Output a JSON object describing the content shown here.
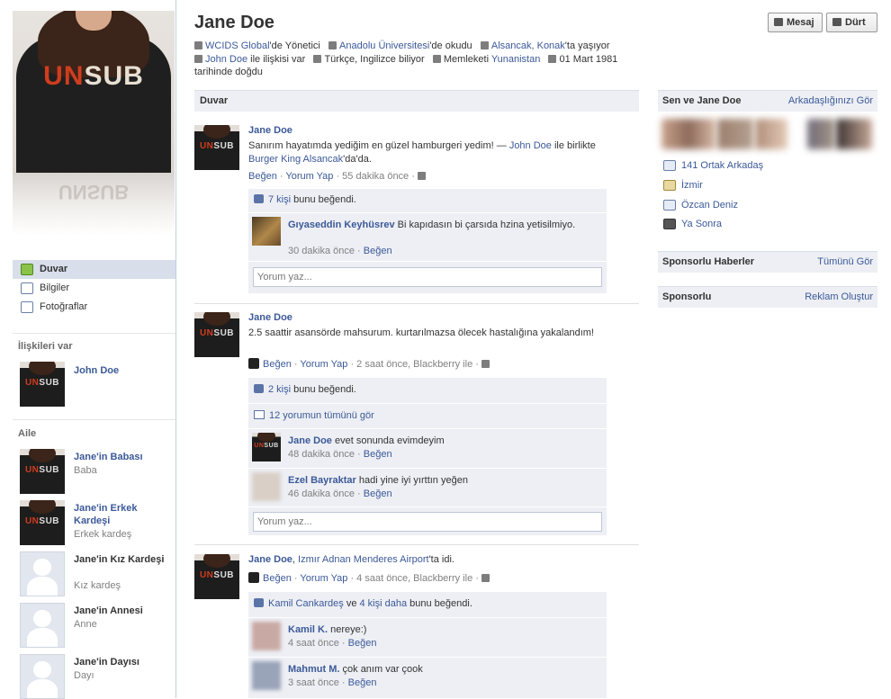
{
  "profile": {
    "name": "Jane Doe",
    "shirt_logo_red": "UN",
    "shirt_logo_white": "SUB"
  },
  "info": {
    "work_org": "WCIDS Global",
    "work_suffix": "'de Yönetici",
    "school": "Anadolu Üniversitesi",
    "school_suffix": "'de okudu",
    "location": "Alsancak, Konak",
    "location_suffix": "'ta yaşıyor",
    "partner": "John Doe",
    "partner_suffix": " ile ilişkisi var",
    "languages": "Türkçe, Ingilizce biliyor",
    "hometown_prefix": "Memleketi ",
    "hometown": "Yunanistan",
    "birthday": "01 Mart 1981 tarihinde doğdu"
  },
  "buttons": {
    "message": "Mesaj",
    "poke": "Dürt"
  },
  "nav": [
    {
      "label": "Duvar"
    },
    {
      "label": "Bilgiler"
    },
    {
      "label": "Fotoğraflar"
    }
  ],
  "relationship": {
    "heading": "İlişkileri var",
    "name": "John Doe"
  },
  "family": {
    "heading": "Aile",
    "members": [
      {
        "name": "Jane'in Babası",
        "role": "Baba"
      },
      {
        "name": "Jane'in Erkek Kardeşi",
        "role": "Erkek kardeş"
      },
      {
        "name": "Jane'in Kız Kardeşi",
        "role": "Kız kardeş"
      },
      {
        "name": "Jane'in Annesi",
        "role": "Anne"
      },
      {
        "name": "Jane'in Dayısı",
        "role": "Dayı"
      }
    ]
  },
  "wall_heading": "Duvar",
  "actions": {
    "like": "Beğen",
    "comment": "Yorum Yap",
    "comment_placeholder": "Yorum yaz..."
  },
  "posts": [
    {
      "author": "Jane Doe",
      "text_a": "Sanırım hayatımda yediğim en güzel hamburgeri yedim! — ",
      "text_tag": "John Doe",
      "text_b": " ile birlikte ",
      "text_place": "Burger King Alsancak",
      "text_c": "'da'da.",
      "meta": " · 55 dakika önce · ",
      "likes_link": "7 kişi",
      "likes_text": " bunu beğendi.",
      "comments": [
        {
          "author": "Gıyaseddin Keyhüsrev",
          "text": "Bi kapıdasın bi çarsıda hzina yetisilmiyo.",
          "time": "30 dakika önce · "
        }
      ]
    },
    {
      "author": "Jane Doe",
      "text": "2.5 saattir asansörde mahsurum. kurtarılmazsa ölecek hastalığına yakalandım!",
      "meta": " · 2 saat önce, Blackberry ile · ",
      "likes_link": "2 kişi",
      "likes_text": " bunu beğendi.",
      "all_comments": "12 yorumun tümünü gör",
      "comments": [
        {
          "author": "Jane Doe",
          "text": "evet sonunda evimdeyim",
          "time": "48 dakika önce · "
        },
        {
          "author": "Ezel Bayraktar",
          "text": "hadi yine iyi yırttın yeğen",
          "time": "46 dakika önce · "
        }
      ]
    },
    {
      "author": "Jane Doe",
      "checkin_sep": ", ",
      "checkin_place": "Izmır Adnan Menderes Airport",
      "checkin_suffix": "'ta idi.",
      "meta": " · 4 saat önce, Blackberry ile · ",
      "likes_link1": "Kamil Cankardeş",
      "likes_mid": " ve ",
      "likes_link2": "4 kişi daha",
      "likes_text": " bunu beğendi.",
      "comments": [
        {
          "author": "Kamil K.",
          "text": "nereye:)",
          "time": "4 saat önce · "
        },
        {
          "author": "Mahmut M.",
          "text": "çok anım var çook",
          "time": "3 saat önce · "
        }
      ]
    }
  ],
  "right": {
    "mutual_heading": "Sen ve Jane Doe",
    "mutual_link": "Arkadaşlığınızı Gör",
    "links": [
      "141 Ortak Arkadaş",
      "İzmir",
      "Özcan Deniz",
      "Ya Sonra"
    ],
    "news_heading": "Sponsorlu Haberler",
    "news_link": "Tümünü Gör",
    "ads_heading": "Sponsorlu",
    "ads_link": "Reklam Oluştur"
  },
  "colors": {
    "link": "#3b5998",
    "header_bg": "#edeff4",
    "nav_selected": "#d8dfea"
  }
}
